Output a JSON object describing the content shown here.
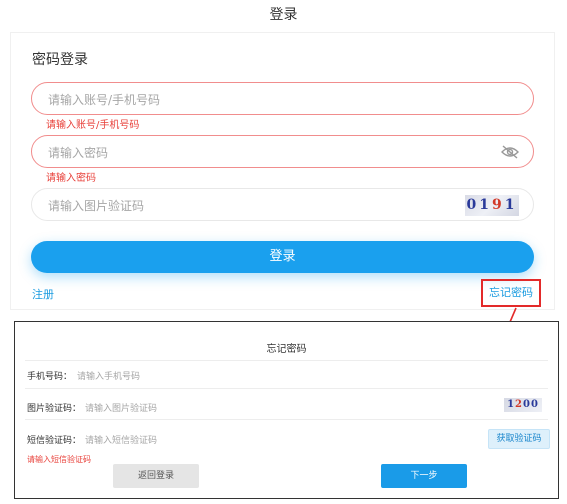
{
  "page": {
    "title": "登录"
  },
  "login": {
    "heading": "密码登录",
    "account": {
      "placeholder": "请输入账号/手机号码",
      "error": "请输入账号/手机号码"
    },
    "password": {
      "placeholder": "请输入密码",
      "error": "请输入密码",
      "icon": "eye-icon"
    },
    "captcha": {
      "placeholder": "请输入图片验证码",
      "image_text": [
        "01",
        "9",
        "1"
      ]
    },
    "submit_label": "登录",
    "register_label": "注册",
    "forgot_label": "忘记密码"
  },
  "forgot_dialog": {
    "title": "忘记密码",
    "phone": {
      "label": "手机号码：",
      "placeholder": "请输入手机号码"
    },
    "image_code": {
      "label": "图片验证码：",
      "placeholder": "请输入图片验证码",
      "image_text": [
        "1",
        "2",
        "00"
      ]
    },
    "sms_code": {
      "label": "短信验证码：",
      "placeholder": "请输入短信验证码",
      "button_label": "获取验证码"
    },
    "error": "请输入短信验证码",
    "back_label": "返回登录",
    "next_label": "下一步"
  },
  "colors": {
    "accent": "#1aa0ee",
    "error": "#e8403a",
    "highlight_box": "#e32a2a"
  }
}
